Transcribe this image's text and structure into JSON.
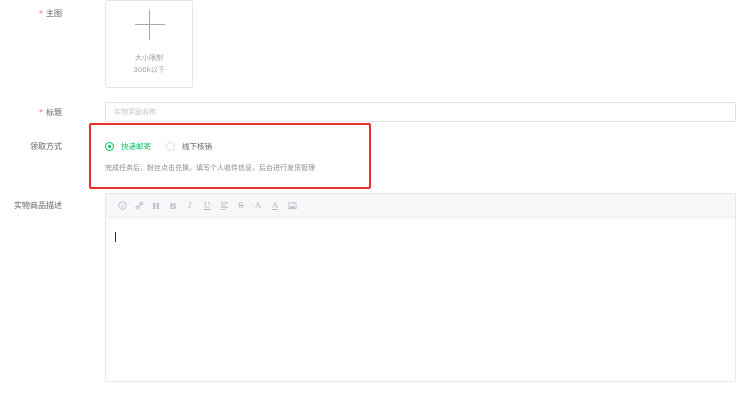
{
  "form": {
    "required_mark": "*",
    "main_image": {
      "label": "主图",
      "upload_hint_line1": "大小限制",
      "upload_hint_line2": "300k以下"
    },
    "title": {
      "label": "标题",
      "placeholder": "实物奖励名称",
      "value": ""
    },
    "pickup_method": {
      "label": "领取方式",
      "options": [
        {
          "label": "快递邮寄",
          "selected": true
        },
        {
          "label": "线下核销",
          "selected": false
        }
      ],
      "hint": "完成任务后，粉丝点击兑换，填写个人收件信息，后台进行发货管理"
    },
    "description": {
      "label": "实物商品描述",
      "content": ""
    }
  },
  "toolbar_icons": [
    "emoji-icon",
    "link-icon",
    "heading-icon",
    "bold-icon",
    "italic-icon",
    "underline-icon",
    "align-icon",
    "strikethrough-icon",
    "font-color-icon",
    "background-color-icon",
    "image-icon"
  ],
  "colors": {
    "accent_green": "#07c160",
    "required_red": "#f56c6c",
    "highlight_red": "#e5322d"
  }
}
